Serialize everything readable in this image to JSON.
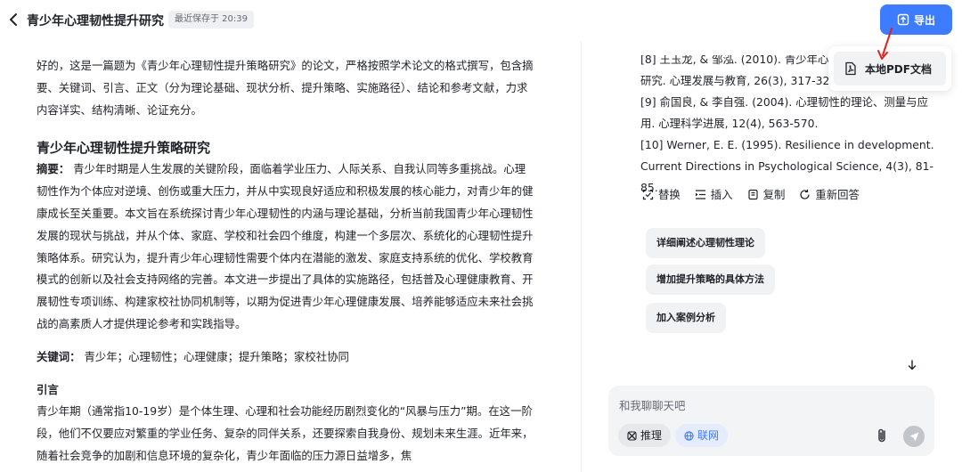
{
  "header": {
    "title": "青少年心理韧性提升研究",
    "save_status": "最近保存于 20:39",
    "export_label": "导出"
  },
  "export_menu": {
    "item_label": "本地PDF文档"
  },
  "document": {
    "intro": "好的，这是一篇题为《青少年心理韧性提升策略研究》的论文，严格按照学术论文的格式撰写，包含摘要、关键词、引言、正文（分为理论基础、现状分析、提升策略、实施路径）、结论和参考文献，力求内容详实、结构清晰、论证充分。",
    "paper_title": "青少年心理韧性提升策略研究",
    "abstract_label": "摘要：",
    "abstract_text": " 青少年时期是人生发展的关键阶段，面临着学业压力、人际关系、自我认同等多重挑战。心理韧性作为个体应对逆境、创伤或重大压力，并从中实现良好适应和积极发展的核心能力，对青少年的健康成长至关重要。本文旨在系统探讨青少年心理韧性的内涵与理论基础，分析当前我国青少年心理韧性发展的现状与挑战，并从个体、家庭、学校和社会四个维度，构建一个多层次、系统化的心理韧性提升策略体系。研究认为，提升青少年心理韧性需要个体内在潜能的激发、家庭支持系统的优化、学校教育模式的创新以及社会支持网络的完善。本文进一步提出了具体的实施路径，包括普及心理健康教育、开展韧性专项训练、构建家校社协同机制等，以期为促进青少年心理健康发展、培养能够适应未来社会挑战的高素质人才提供理论参考和实践指导。",
    "keywords_label": "关键词：",
    "keywords_text": " 青少年；心理韧性；心理健康；提升策略；家校社协同",
    "intro_heading": "引言",
    "intro_text": "青少年期（通常指10-19岁）是个体生理、心理和社会功能经历剧烈变化的“风暴与压力”期。在这一阶段，他们不仅要应对繁重的学业任务、复杂的同伴关系，还要探索自我身份、规划未来生涯。近年来，随着社会竞争的加剧和信息环境的复杂化，青少年面临的压力源日益增多，焦"
  },
  "chat": {
    "references": [
      "[8] 王玉龙, & 邹泓. (2010). 青少年心理",
      "研究. 心理发展与教育, 26(3), 317-323.",
      "[9] 俞国良, & 李自强. (2004). 心理韧性的理论、测量与应用. 心理科学进展, 12(4), 563-570.",
      "[10] Werner, E. E. (1995). Resilience in development. Current Directions in Psychological Science, 4(3), 81-85."
    ],
    "actions": [
      {
        "label": "替换",
        "icon": "replace-icon"
      },
      {
        "label": "插入",
        "icon": "insert-icon"
      },
      {
        "label": "复制",
        "icon": "copy-icon"
      },
      {
        "label": "重新回答",
        "icon": "regenerate-icon"
      }
    ],
    "suggestions": [
      "详细阐述心理韧性理论",
      "增加提升策略的具体方法",
      "加入案例分析"
    ],
    "input": {
      "placeholder": "和我聊聊天吧",
      "value": ""
    },
    "chips": {
      "reasoning": "推理",
      "web": "联网"
    }
  },
  "colors": {
    "accent": "#3d7bff",
    "annotation_arrow": "#e02020"
  }
}
